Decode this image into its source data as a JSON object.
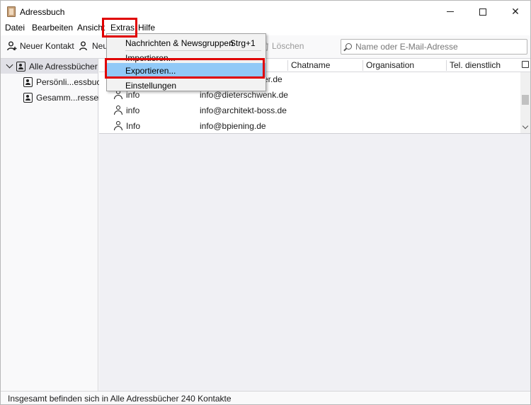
{
  "window": {
    "title": "Adressbuch"
  },
  "menubar": {
    "items": [
      "Datei",
      "Bearbeiten",
      "Ansicht",
      "Extras",
      "Hilfe"
    ],
    "active": "Extras"
  },
  "toolbar": {
    "new_contact": "Neuer Kontakt",
    "new_list": "Neu",
    "delete": "Löschen",
    "search_placeholder": "Name oder E-Mail-Adresse"
  },
  "sidebar": {
    "items": [
      {
        "label": "Alle Adressbücher",
        "selected": true
      },
      {
        "label": "Persönli...essbuch",
        "selected": false
      },
      {
        "label": "Gesamm...ressen",
        "selected": false
      }
    ]
  },
  "columns": {
    "chat": "Chatname",
    "org": "Organisation",
    "tel": "Tel. dienstlich"
  },
  "rows": [
    {
      "name": "",
      "email": "er.de"
    },
    {
      "name": "info",
      "email": "info@dieterschwenk.de"
    },
    {
      "name": "info",
      "email": "info@architekt-boss.de"
    },
    {
      "name": "Info",
      "email": "info@bpiening.de"
    }
  ],
  "dropdown": {
    "items": [
      {
        "label": "Nachrichten & Newsgruppen",
        "shortcut": "Strg+1"
      },
      {
        "label": "Importieren...",
        "shortcut": ""
      },
      {
        "label": "Exportieren...",
        "shortcut": ""
      },
      {
        "label": "Einstellungen",
        "shortcut": ""
      }
    ],
    "hover_index": 2
  },
  "status": {
    "text": "Insgesamt befinden sich in Alle Adressbücher 240 Kontakte"
  },
  "colors": {
    "highlight": "#e00000",
    "menu_hover": "#91c9f7"
  }
}
